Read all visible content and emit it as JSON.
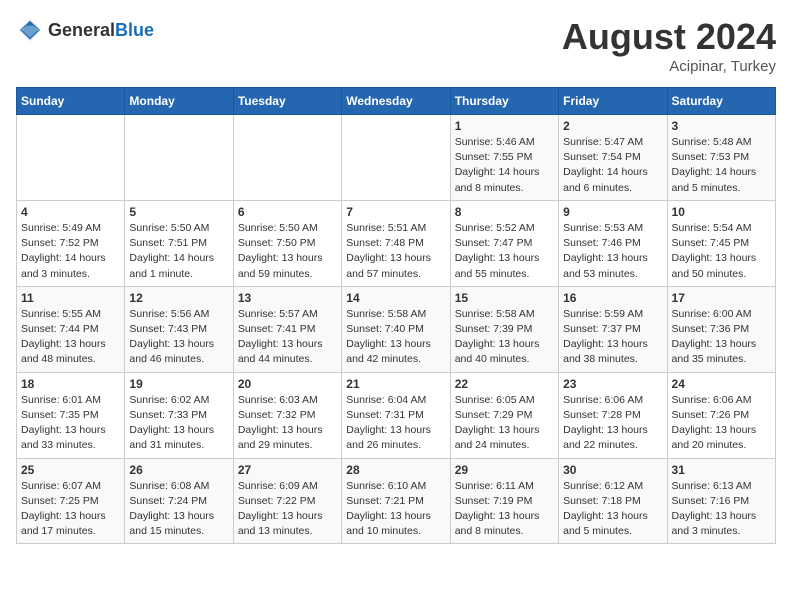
{
  "header": {
    "logo_general": "General",
    "logo_blue": "Blue",
    "title": "August 2024",
    "subtitle": "Acipinar, Turkey"
  },
  "weekdays": [
    "Sunday",
    "Monday",
    "Tuesday",
    "Wednesday",
    "Thursday",
    "Friday",
    "Saturday"
  ],
  "weeks": [
    [
      {
        "day": "",
        "info": ""
      },
      {
        "day": "",
        "info": ""
      },
      {
        "day": "",
        "info": ""
      },
      {
        "day": "",
        "info": ""
      },
      {
        "day": "1",
        "info": "Sunrise: 5:46 AM\nSunset: 7:55 PM\nDaylight: 14 hours\nand 8 minutes."
      },
      {
        "day": "2",
        "info": "Sunrise: 5:47 AM\nSunset: 7:54 PM\nDaylight: 14 hours\nand 6 minutes."
      },
      {
        "day": "3",
        "info": "Sunrise: 5:48 AM\nSunset: 7:53 PM\nDaylight: 14 hours\nand 5 minutes."
      }
    ],
    [
      {
        "day": "4",
        "info": "Sunrise: 5:49 AM\nSunset: 7:52 PM\nDaylight: 14 hours\nand 3 minutes."
      },
      {
        "day": "5",
        "info": "Sunrise: 5:50 AM\nSunset: 7:51 PM\nDaylight: 14 hours\nand 1 minute."
      },
      {
        "day": "6",
        "info": "Sunrise: 5:50 AM\nSunset: 7:50 PM\nDaylight: 13 hours\nand 59 minutes."
      },
      {
        "day": "7",
        "info": "Sunrise: 5:51 AM\nSunset: 7:48 PM\nDaylight: 13 hours\nand 57 minutes."
      },
      {
        "day": "8",
        "info": "Sunrise: 5:52 AM\nSunset: 7:47 PM\nDaylight: 13 hours\nand 55 minutes."
      },
      {
        "day": "9",
        "info": "Sunrise: 5:53 AM\nSunset: 7:46 PM\nDaylight: 13 hours\nand 53 minutes."
      },
      {
        "day": "10",
        "info": "Sunrise: 5:54 AM\nSunset: 7:45 PM\nDaylight: 13 hours\nand 50 minutes."
      }
    ],
    [
      {
        "day": "11",
        "info": "Sunrise: 5:55 AM\nSunset: 7:44 PM\nDaylight: 13 hours\nand 48 minutes."
      },
      {
        "day": "12",
        "info": "Sunrise: 5:56 AM\nSunset: 7:43 PM\nDaylight: 13 hours\nand 46 minutes."
      },
      {
        "day": "13",
        "info": "Sunrise: 5:57 AM\nSunset: 7:41 PM\nDaylight: 13 hours\nand 44 minutes."
      },
      {
        "day": "14",
        "info": "Sunrise: 5:58 AM\nSunset: 7:40 PM\nDaylight: 13 hours\nand 42 minutes."
      },
      {
        "day": "15",
        "info": "Sunrise: 5:58 AM\nSunset: 7:39 PM\nDaylight: 13 hours\nand 40 minutes."
      },
      {
        "day": "16",
        "info": "Sunrise: 5:59 AM\nSunset: 7:37 PM\nDaylight: 13 hours\nand 38 minutes."
      },
      {
        "day": "17",
        "info": "Sunrise: 6:00 AM\nSunset: 7:36 PM\nDaylight: 13 hours\nand 35 minutes."
      }
    ],
    [
      {
        "day": "18",
        "info": "Sunrise: 6:01 AM\nSunset: 7:35 PM\nDaylight: 13 hours\nand 33 minutes."
      },
      {
        "day": "19",
        "info": "Sunrise: 6:02 AM\nSunset: 7:33 PM\nDaylight: 13 hours\nand 31 minutes."
      },
      {
        "day": "20",
        "info": "Sunrise: 6:03 AM\nSunset: 7:32 PM\nDaylight: 13 hours\nand 29 minutes."
      },
      {
        "day": "21",
        "info": "Sunrise: 6:04 AM\nSunset: 7:31 PM\nDaylight: 13 hours\nand 26 minutes."
      },
      {
        "day": "22",
        "info": "Sunrise: 6:05 AM\nSunset: 7:29 PM\nDaylight: 13 hours\nand 24 minutes."
      },
      {
        "day": "23",
        "info": "Sunrise: 6:06 AM\nSunset: 7:28 PM\nDaylight: 13 hours\nand 22 minutes."
      },
      {
        "day": "24",
        "info": "Sunrise: 6:06 AM\nSunset: 7:26 PM\nDaylight: 13 hours\nand 20 minutes."
      }
    ],
    [
      {
        "day": "25",
        "info": "Sunrise: 6:07 AM\nSunset: 7:25 PM\nDaylight: 13 hours\nand 17 minutes."
      },
      {
        "day": "26",
        "info": "Sunrise: 6:08 AM\nSunset: 7:24 PM\nDaylight: 13 hours\nand 15 minutes."
      },
      {
        "day": "27",
        "info": "Sunrise: 6:09 AM\nSunset: 7:22 PM\nDaylight: 13 hours\nand 13 minutes."
      },
      {
        "day": "28",
        "info": "Sunrise: 6:10 AM\nSunset: 7:21 PM\nDaylight: 13 hours\nand 10 minutes."
      },
      {
        "day": "29",
        "info": "Sunrise: 6:11 AM\nSunset: 7:19 PM\nDaylight: 13 hours\nand 8 minutes."
      },
      {
        "day": "30",
        "info": "Sunrise: 6:12 AM\nSunset: 7:18 PM\nDaylight: 13 hours\nand 5 minutes."
      },
      {
        "day": "31",
        "info": "Sunrise: 6:13 AM\nSunset: 7:16 PM\nDaylight: 13 hours\nand 3 minutes."
      }
    ]
  ]
}
